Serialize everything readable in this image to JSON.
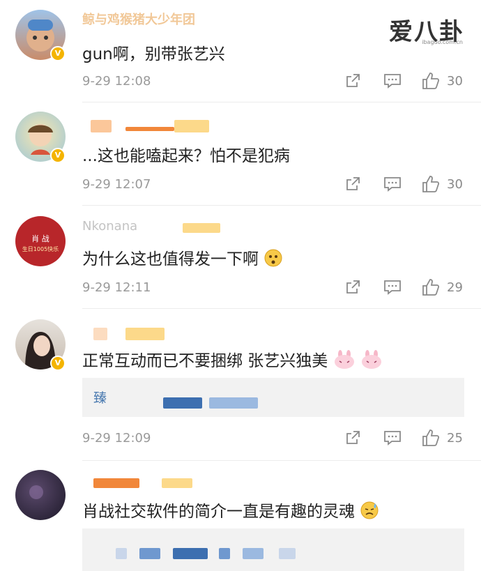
{
  "watermark": {
    "brand": "爱八卦",
    "site": "ibaguo.com.cn"
  },
  "comments": [
    {
      "name": "鲸与鸡猴猪大少年团",
      "text": "gun啊，别带张艺兴",
      "time": "9-29 12:08",
      "likes": "30",
      "icons": {
        "share": "share-icon",
        "reply": "comment-icon",
        "like": "thumbs-up-icon"
      }
    },
    {
      "name": "",
      "text": "...这也能嗑起来？怕不是犯病",
      "time": "9-29 12:07",
      "likes": "30"
    },
    {
      "name": "Nkonana",
      "text": "为什么这也值得发一下啊",
      "time": "9-29 12:11",
      "likes": "29",
      "avatar_text": "肖 战",
      "avatar_caption": "生日1005快乐"
    },
    {
      "name": "",
      "text": "正常互动而已不要捆绑 张艺兴独美",
      "time": "9-29 12:09",
      "likes": "25",
      "quote_name": "臻"
    },
    {
      "name": "",
      "text": "肖战社交软件的简介一直是有趣的灵魂",
      "time": "",
      "likes": ""
    }
  ],
  "colors": {
    "badge": "#f4b400",
    "text": "#222222",
    "meta": "#9a9a9a",
    "icon": "#8a8a8a"
  }
}
